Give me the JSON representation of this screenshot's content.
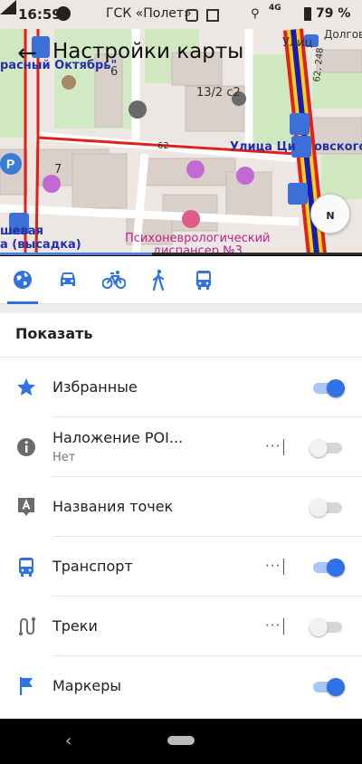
{
  "status_bar": {
    "time": "16:59",
    "network_name": "ГСК «Полет»",
    "network_type": "4G",
    "battery": "79 %"
  },
  "header": {
    "back_icon": "arrow-left-icon",
    "title": "Настройки карты"
  },
  "map": {
    "labels": {
      "street_top": "расный Октябрь\"",
      "ulitsa_right_top": "Улиц",
      "dolgov": "Долгов",
      "num_6": "6",
      "num_13_2": "13/2 с2",
      "num_7": "7",
      "road_62": "62",
      "road_62_248": "62, 248",
      "ulitsa_right": "Улица Ци",
      "ulitsa_right_end": "овского",
      "stop_left_1": "шевая",
      "stop_left_2": "а (высадка)",
      "dispensary_1": "Психоневрологический",
      "dispensary_2": "диспансер №3"
    },
    "compass_label": "N",
    "progress": 0.42
  },
  "profile_tabs": [
    {
      "name": "globe-icon",
      "selected": true
    },
    {
      "name": "car-icon",
      "selected": false
    },
    {
      "name": "bicycle-icon",
      "selected": false
    },
    {
      "name": "pedestrian-icon",
      "selected": false
    },
    {
      "name": "bus-icon",
      "selected": false
    }
  ],
  "section": {
    "title": "Показать"
  },
  "rows": [
    {
      "icon": "star-icon",
      "title": "Избранные",
      "subtitle": "",
      "has_more": false,
      "enabled": true
    },
    {
      "icon": "info-icon",
      "title": "Наложение POI...",
      "subtitle": "Нет",
      "has_more": true,
      "enabled": false
    },
    {
      "icon": "point-name-icon",
      "title": "Названия точек",
      "subtitle": "",
      "has_more": false,
      "enabled": false
    },
    {
      "icon": "bus-icon",
      "title": "Транспорт",
      "subtitle": "",
      "has_more": true,
      "enabled": true
    },
    {
      "icon": "track-icon",
      "title": "Треки",
      "subtitle": "",
      "has_more": true,
      "enabled": false
    },
    {
      "icon": "flag-icon",
      "title": "Маркеры",
      "subtitle": "",
      "has_more": false,
      "enabled": true
    }
  ],
  "more_label": "···",
  "colors": {
    "accent": "#2f72e6",
    "route_red": "#e0201b",
    "route_blue": "#1a1ab8",
    "map_bg": "#ece7e2",
    "park_green": "#cfe8c0"
  }
}
